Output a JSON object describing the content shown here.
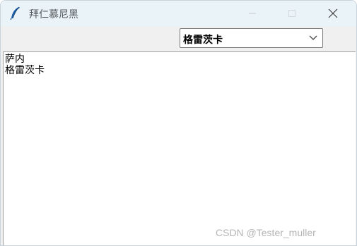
{
  "window": {
    "title": "拜仁慕尼黑"
  },
  "icons": {
    "app": "feather-icon",
    "minimize": "minimize-icon",
    "maximize": "maximize-icon",
    "close": "close-icon",
    "dropdown": "chevron-down-icon"
  },
  "combobox": {
    "selected": "格雷茨卡"
  },
  "text_area": {
    "lines": [
      "萨内",
      "格雷茨卡"
    ]
  },
  "watermark": "CSDN @Tester_muller",
  "colors": {
    "titlebar": "#eaf3f7",
    "window_bg": "#f0f0f0",
    "text": "#000000"
  }
}
